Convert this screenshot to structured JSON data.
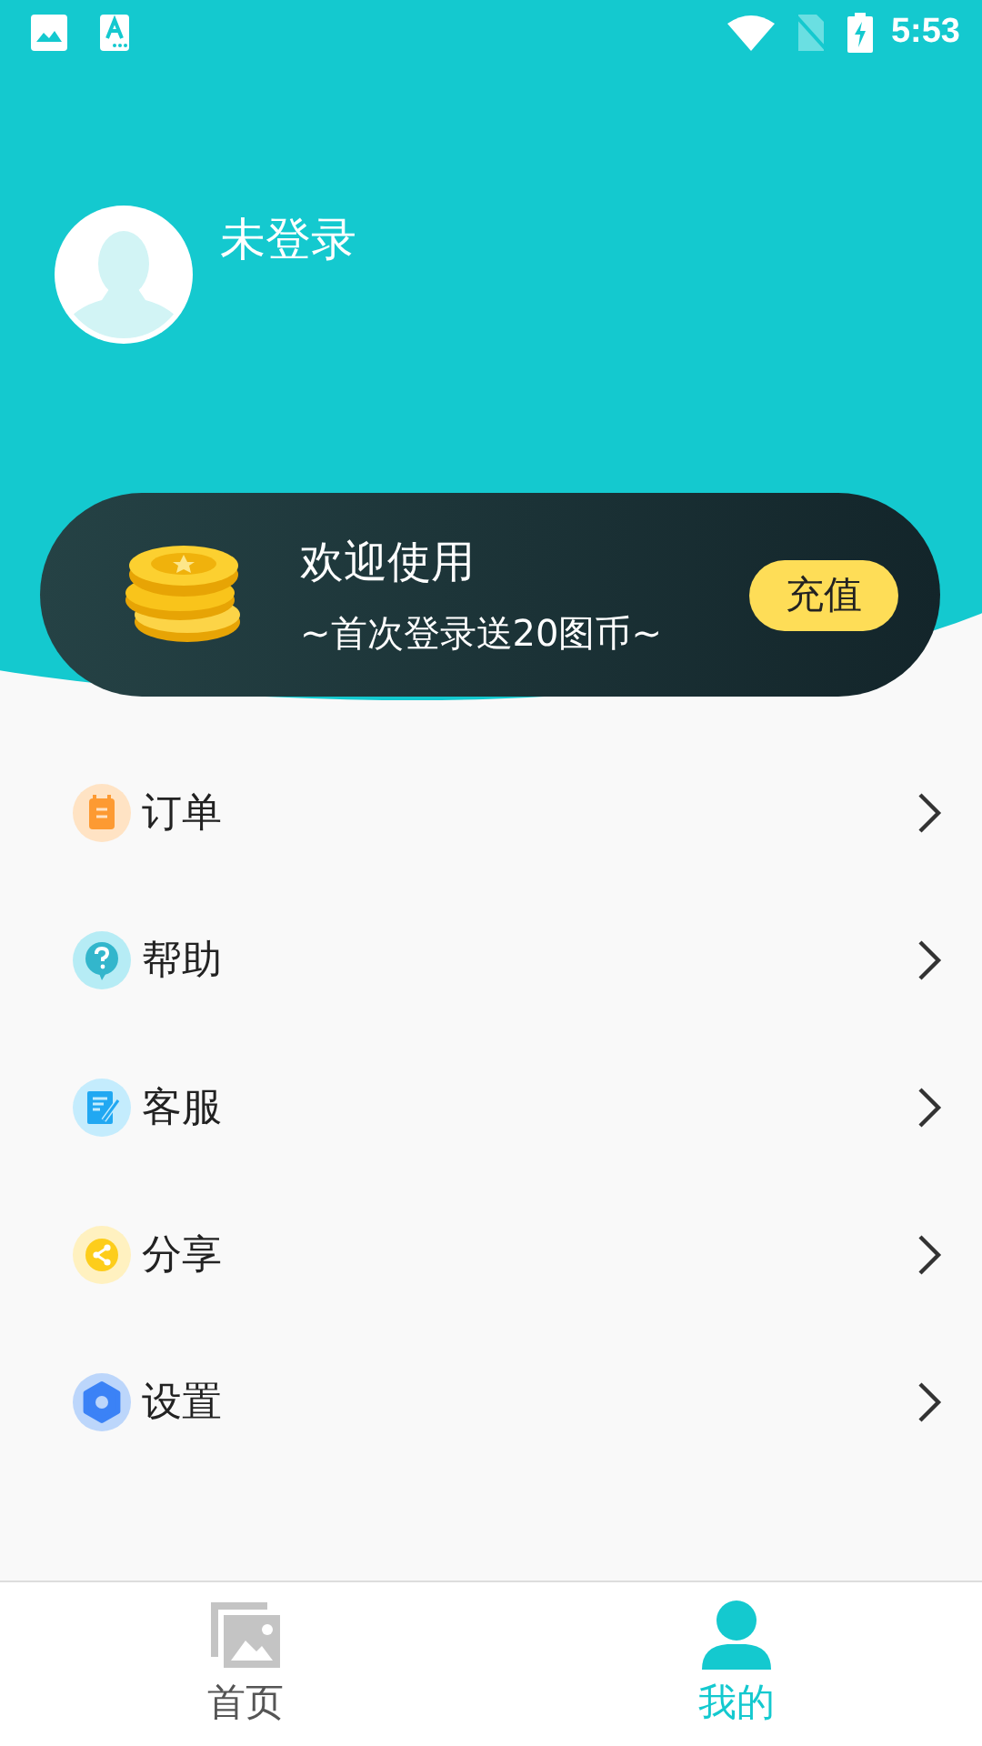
{
  "status_bar": {
    "time": "5:53"
  },
  "profile": {
    "name": "未登录"
  },
  "promo": {
    "title": "欢迎使用",
    "subtitle": "~首次登录送20图币~",
    "button": "充值"
  },
  "menu": [
    {
      "label": "订单",
      "kind": "order"
    },
    {
      "label": "帮助",
      "kind": "help"
    },
    {
      "label": "客服",
      "kind": "service"
    },
    {
      "label": "分享",
      "kind": "share"
    },
    {
      "label": "设置",
      "kind": "settings"
    }
  ],
  "tabs": [
    {
      "label": "首页",
      "kind": "home",
      "selected": false
    },
    {
      "label": "我的",
      "kind": "mine",
      "selected": true
    }
  ]
}
